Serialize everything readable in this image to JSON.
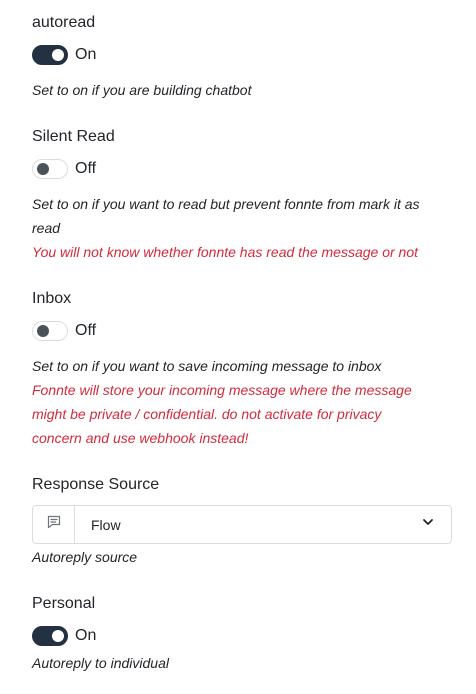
{
  "autoread": {
    "title": "autoread",
    "state": "On",
    "help": "Set to on if you are building chatbot"
  },
  "silent_read": {
    "title": "Silent Read",
    "state": "Off",
    "help_line1": "Set to on if you want to read but prevent fonnte from mark it as",
    "help_line2": "read",
    "warning": "You will not know whether fonnte has read the message or not"
  },
  "inbox": {
    "title": "Inbox",
    "state": "Off",
    "help": "Set to on if you want to save incoming message to inbox",
    "warning_line1": "Fonnte will store your incoming message where the message",
    "warning_line2": "might be private / confidential. do not activate for privacy",
    "warning_line3": "concern and use webhook instead!"
  },
  "response_source": {
    "title": "Response Source",
    "selected": "Flow",
    "help": "Autoreply source",
    "icon": "message-square-icon"
  },
  "personal": {
    "title": "Personal",
    "state": "On",
    "help": "Autoreply to individual"
  },
  "colors": {
    "toggle_on": "#233142",
    "warning": "#d22b3c",
    "text": "#212529",
    "border": "#d9dde2"
  }
}
